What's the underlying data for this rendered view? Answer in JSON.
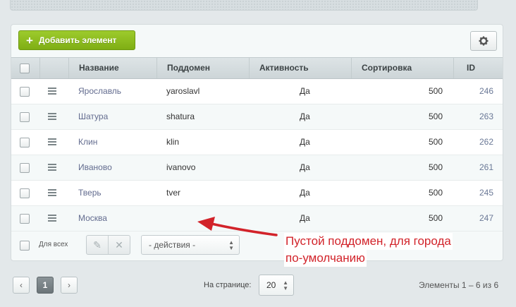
{
  "toolbar": {
    "add_label": "Добавить элемент",
    "settings_icon": "gear-icon"
  },
  "columns": [
    "Название",
    "Поддомен",
    "Активность",
    "Сортировка",
    "ID"
  ],
  "rows": [
    {
      "name": "Ярославль",
      "subdomain": "yaroslavl",
      "active": "Да",
      "sort": "500",
      "id": "246"
    },
    {
      "name": "Шатура",
      "subdomain": "shatura",
      "active": "Да",
      "sort": "500",
      "id": "263"
    },
    {
      "name": "Клин",
      "subdomain": "klin",
      "active": "Да",
      "sort": "500",
      "id": "262"
    },
    {
      "name": "Иваново",
      "subdomain": "ivanovo",
      "active": "Да",
      "sort": "500",
      "id": "261"
    },
    {
      "name": "Тверь",
      "subdomain": "tver",
      "active": "Да",
      "sort": "500",
      "id": "245"
    },
    {
      "name": "Москва",
      "subdomain": "",
      "active": "Да",
      "sort": "500",
      "id": "247"
    }
  ],
  "footer": {
    "for_all_label": "Для всех",
    "actions_selected": "- действия -"
  },
  "annotation": {
    "line1": "Пустой поддомен, для города",
    "line2": "по-умолчанию",
    "color": "#d2232a"
  },
  "pagination": {
    "prev": "‹",
    "current_page": "1",
    "next": "›",
    "per_page_label": "На странице:",
    "per_page_value": "20",
    "summary": "Элементы 1 – 6 из 6"
  },
  "colors": {
    "add_button": "#8cbb1f",
    "link": "#636c8f"
  }
}
